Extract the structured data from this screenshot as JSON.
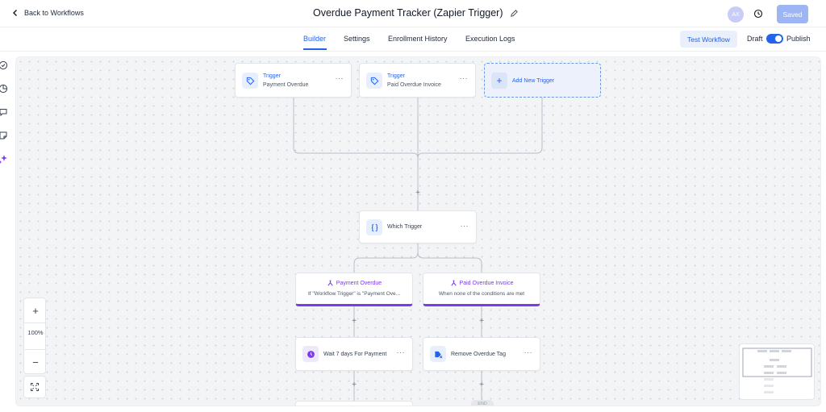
{
  "header": {
    "back_label": "Back to Workflows",
    "title": "Overdue Payment Tracker (Zapier Trigger)",
    "avatar_initials": "AX",
    "saved_label": "Saved"
  },
  "tabs": {
    "items": [
      "Builder",
      "Settings",
      "Enrollment History",
      "Execution Logs"
    ],
    "active": "Builder",
    "test_label": "Test Workflow",
    "draft_label": "Draft",
    "publish_label": "Publish",
    "publish_on": true
  },
  "triggers": [
    {
      "type": "Trigger",
      "name": "Payment Overdue"
    },
    {
      "type": "Trigger",
      "name": "Paid Overdue Invoice"
    }
  ],
  "add_trigger_label": "Add New Trigger",
  "router": {
    "label": "Which Trigger"
  },
  "branches": [
    {
      "title": "Payment Overdue",
      "subtitle": "If \"Workflow Trigger\" is \"Payment Ove..."
    },
    {
      "title": "Paid Overdue Invoice",
      "subtitle": "When none of the conditions are met"
    }
  ],
  "actions": [
    {
      "label": "Wait 7 days For Payment",
      "icon": "clock-icon"
    },
    {
      "label": "Remove Overdue Tag",
      "icon": "tag-remove-icon"
    }
  ],
  "end_label": "END",
  "zoom": {
    "level": "100%"
  },
  "colors": {
    "accent": "#2563eb",
    "branch": "#7c3aed",
    "saved_button": "#9db5f3"
  }
}
